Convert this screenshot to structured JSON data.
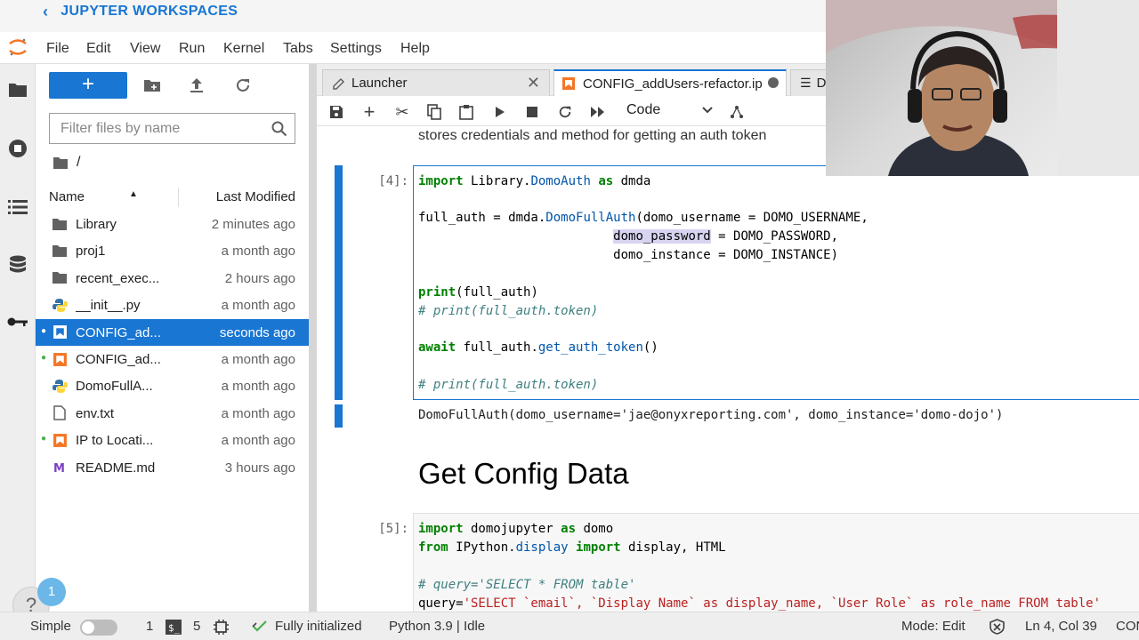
{
  "workspace": {
    "back_label": "JUPYTER WORKSPACES"
  },
  "menu": [
    "File",
    "Edit",
    "View",
    "Run",
    "Kernel",
    "Tabs",
    "Settings",
    "Help"
  ],
  "filebrowser": {
    "new_label": "+",
    "filter_placeholder": "Filter files by name",
    "breadcrumb": "/",
    "col_name": "Name",
    "col_modified": "Last Modified",
    "files": [
      {
        "name": "Library",
        "modified": "2 minutes ago",
        "icon": "folder-icon",
        "running": false,
        "selected": false
      },
      {
        "name": "proj1",
        "modified": "a month ago",
        "icon": "folder-icon",
        "running": false,
        "selected": false
      },
      {
        "name": "recent_exec...",
        "modified": "2 hours ago",
        "icon": "folder-icon",
        "running": false,
        "selected": false
      },
      {
        "name": "__init__.py",
        "modified": "a month ago",
        "icon": "python-icon",
        "running": false,
        "selected": false
      },
      {
        "name": "CONFIG_ad...",
        "modified": "seconds ago",
        "icon": "notebook-icon",
        "running": true,
        "selected": true
      },
      {
        "name": "CONFIG_ad...",
        "modified": "a month ago",
        "icon": "notebook-icon",
        "running": true,
        "selected": false
      },
      {
        "name": "DomoFullA...",
        "modified": "a month ago",
        "icon": "python-icon",
        "running": false,
        "selected": false
      },
      {
        "name": "env.txt",
        "modified": "a month ago",
        "icon": "file-icon",
        "running": false,
        "selected": false
      },
      {
        "name": "IP to Locati...",
        "modified": "a month ago",
        "icon": "notebook-icon",
        "running": true,
        "selected": false
      },
      {
        "name": "README.md",
        "modified": "3 hours ago",
        "icon": "markdown-icon",
        "running": false,
        "selected": false
      }
    ]
  },
  "tabs": [
    {
      "label": "Launcher"
    },
    {
      "label": "CONFIG_addUsers-refactor.ip"
    },
    {
      "label": "D"
    }
  ],
  "toolbar": {
    "cell_type": "Code"
  },
  "notebook": {
    "md_line": "stores credentials and method for getting an auth token",
    "cell4_prompt": "[4]:",
    "cell4_output": "DomoFullAuth(domo_username='jae@onyxreporting.com', domo_instance='domo-dojo')",
    "heading": "Get Config Data",
    "cell5_prompt": "[5]:"
  },
  "status": {
    "mode_label": "Simple",
    "terminals": "1",
    "kernels": "5",
    "init": "Fully initialized",
    "kernel": "Python 3.9 | Idle",
    "edit_mode": "Mode: Edit",
    "position": "Ln 4, Col 39",
    "trailing": "CON"
  },
  "help": {
    "badge": "1",
    "glyph": "?"
  },
  "colors": {
    "accent": "#1976d2",
    "running_dot": "#4caf50"
  }
}
